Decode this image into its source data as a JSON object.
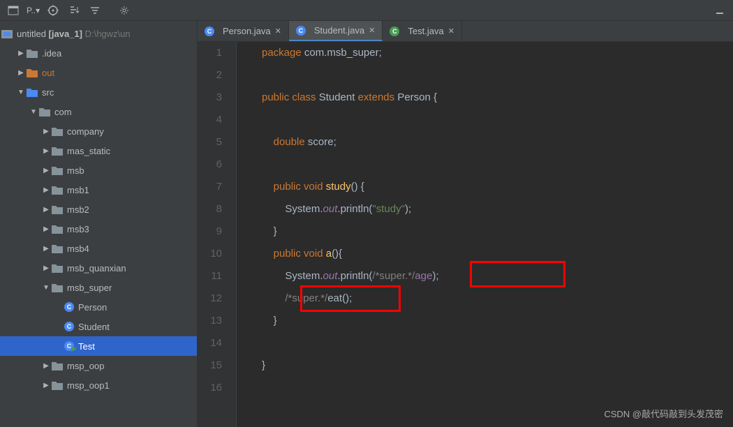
{
  "toolbar": {
    "project_label": "P..▾"
  },
  "tree": {
    "root": {
      "name": "untitled",
      "mod": "[java_1]",
      "path": "D:\\hgwz\\un"
    },
    "nodes": [
      {
        "depth": 1,
        "arrow": "▶",
        "kind": "folder",
        "label": ".idea"
      },
      {
        "depth": 1,
        "arrow": "▶",
        "kind": "folder-orange",
        "label": "out"
      },
      {
        "depth": 1,
        "arrow": "▼",
        "kind": "folder-blue",
        "label": "src"
      },
      {
        "depth": 2,
        "arrow": "▼",
        "kind": "folder",
        "label": "com"
      },
      {
        "depth": 3,
        "arrow": "▶",
        "kind": "folder",
        "label": "company"
      },
      {
        "depth": 3,
        "arrow": "▶",
        "kind": "folder",
        "label": "mas_static"
      },
      {
        "depth": 3,
        "arrow": "▶",
        "kind": "folder",
        "label": "msb"
      },
      {
        "depth": 3,
        "arrow": "▶",
        "kind": "folder",
        "label": "msb1"
      },
      {
        "depth": 3,
        "arrow": "▶",
        "kind": "folder",
        "label": "msb2"
      },
      {
        "depth": 3,
        "arrow": "▶",
        "kind": "folder",
        "label": "msb3"
      },
      {
        "depth": 3,
        "arrow": "▶",
        "kind": "folder",
        "label": "msb4"
      },
      {
        "depth": 3,
        "arrow": "▶",
        "kind": "folder",
        "label": "msb_quanxian"
      },
      {
        "depth": 3,
        "arrow": "▼",
        "kind": "folder",
        "label": "msb_super"
      },
      {
        "depth": 4,
        "arrow": "",
        "kind": "class",
        "label": "Person"
      },
      {
        "depth": 4,
        "arrow": "",
        "kind": "class",
        "label": "Student"
      },
      {
        "depth": 4,
        "arrow": "",
        "kind": "class-run",
        "label": "Test",
        "selected": true
      },
      {
        "depth": 3,
        "arrow": "▶",
        "kind": "folder",
        "label": "msp_oop"
      },
      {
        "depth": 3,
        "arrow": "▶",
        "kind": "folder",
        "label": "msp_oop1"
      }
    ]
  },
  "tabs": [
    {
      "label": "Person.java",
      "icon": "class",
      "active": false
    },
    {
      "label": "Student.java",
      "icon": "class",
      "active": true
    },
    {
      "label": "Test.java",
      "icon": "class-run",
      "active": false
    }
  ],
  "code": {
    "lines": [
      "1",
      "2",
      "3",
      "4",
      "5",
      "6",
      "7",
      "8",
      "9",
      "10",
      "11",
      "12",
      "13",
      "14",
      "15",
      "16"
    ],
    "l1_package": "package ",
    "l1_pkg": "com.msb_super",
    "l1_semi": ";",
    "l3_public": "public ",
    "l3_class": "class ",
    "l3_name": "Student ",
    "l3_extends": "extends ",
    "l3_super": "Person ",
    "l3_brace": "{",
    "l5_ind": "    ",
    "l5_double": "double ",
    "l5_score": "score",
    "l5_semi": ";",
    "l7_ind": "    ",
    "l7_public": "public ",
    "l7_void": "void ",
    "l7_name": "study",
    "l7_paren": "() {",
    "l8_ind": "        ",
    "l8_sys": "System.",
    "l8_out": "out",
    "l8_dot": ".",
    "l8_println": "println",
    "l8_open": "(",
    "l8_str": "\"study\"",
    "l8_close": ");",
    "l9_ind": "    ",
    "l9_brace": "}",
    "l10_ind": "    ",
    "l10_public": "public ",
    "l10_void": "void ",
    "l10_name": "a",
    "l10_paren": "(){",
    "l11_ind": "        ",
    "l11_sys": "System.",
    "l11_out": "out",
    "l11_dot": ".",
    "l11_println": "println",
    "l11_open": "(",
    "l11_comment": "/*super.*/",
    "l11_age": "age",
    "l11_close": ");",
    "l12_ind": "        ",
    "l12_comment": "/*super.*/",
    "l12_eat": "eat",
    "l12_paren": "();",
    "l13_ind": "    ",
    "l13_brace": "}",
    "l15_brace": "}"
  },
  "watermark": "CSDN @敲代码敲到头发茂密"
}
